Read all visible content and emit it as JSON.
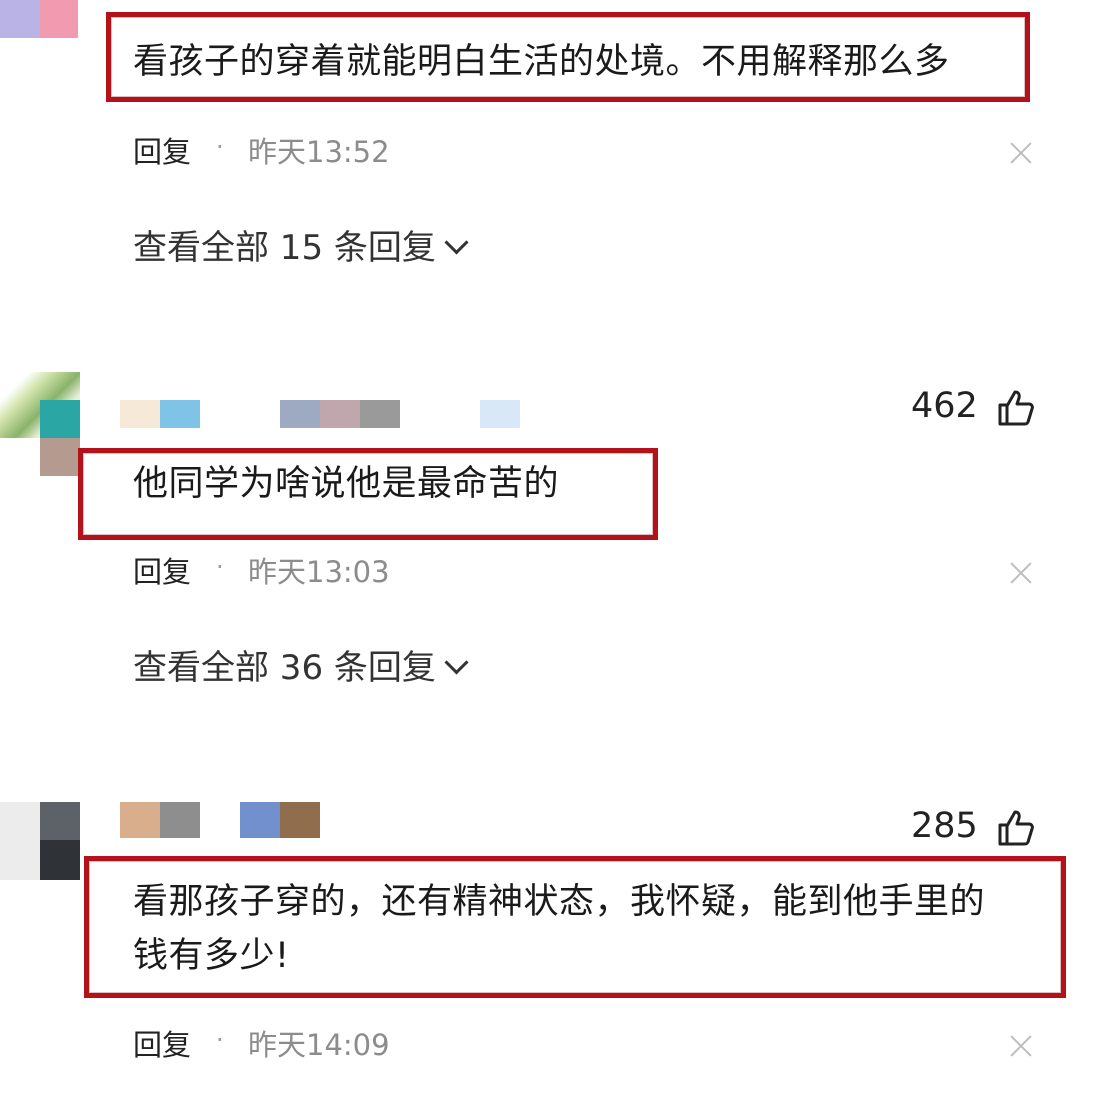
{
  "comments": [
    {
      "text": "看孩子的穿着就能明白生活的处境。不用解释那么多",
      "reply_label": "回复",
      "separator": "·",
      "time": "昨天13:52",
      "view_all": "查看全部 15 条回复"
    },
    {
      "likes": "462",
      "text": "他同学为啥说他是最命苦的",
      "reply_label": "回复",
      "separator": "·",
      "time": "昨天13:03",
      "view_all": "查看全部 36 条回复"
    },
    {
      "likes": "285",
      "text_line1": "看那孩子穿的，还有精神状态，我怀疑，能到他手里的",
      "text_line2": "钱有多少!",
      "reply_label": "回复",
      "separator": "·",
      "time": "昨天14:09"
    }
  ],
  "colors": {
    "highlight_box": "#b3121b",
    "time": "#8c8c8c"
  },
  "icons": [
    "close-icon",
    "thumbs-up-icon",
    "chevron-down-icon"
  ]
}
